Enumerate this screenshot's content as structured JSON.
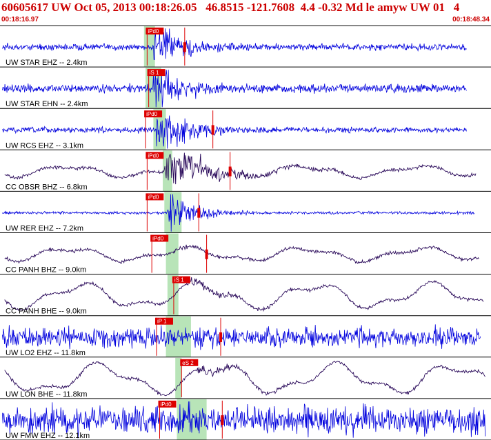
{
  "header": {
    "title": "60605617 UW Oct 05, 2013 00:18:26.05   46.8515 -121.7608  4.4 -0.32 Md le amyw UW 01   4",
    "start_time": "00:18:16.97",
    "end_time": "00:18:48.34"
  },
  "colors": {
    "header_text": "#cc0000",
    "trace_short_period": "#0000dd",
    "trace_broadband": "#2a0a5a",
    "pick_marker": "#dd0000",
    "pick_window": "#b8e4b8",
    "divider": "#000000"
  },
  "chart_data": {
    "type": "line",
    "title": "",
    "x_range_s": [
      0,
      31.37
    ],
    "traces": [
      {
        "label": "UW STAR EHZ -- 2.4km",
        "kind": "short",
        "amp": 0.12,
        "burst": 0.95,
        "burst_start": 9.8,
        "decay": 2.2,
        "picks": [
          {
            "label": "iPd0",
            "t": 9.4
          },
          {
            "label": "S",
            "t": 11.8
          }
        ],
        "window": [
          9.2,
          9.9
        ],
        "end_t": 29.8
      },
      {
        "label": "UW STAR EHN -- 2.4km",
        "kind": "short",
        "amp": 0.15,
        "burst": 0.9,
        "burst_start": 9.8,
        "decay": 2.0,
        "picks": [
          {
            "label": "iS 1",
            "t": 9.5
          }
        ],
        "window": [
          9.3,
          10.3
        ],
        "end_t": 29.8
      },
      {
        "label": "UW RCS EHZ -- 3.1km",
        "kind": "short",
        "amp": 0.1,
        "burst": 0.95,
        "burst_start": 10.0,
        "decay": 2.3,
        "picks": [
          {
            "label": "iPd0",
            "t": 9.3
          },
          {
            "label": "S",
            "t": 13.6
          }
        ],
        "window": [
          9.8,
          10.6
        ],
        "end_t": 29.8
      },
      {
        "label": "CC OBSR BHZ -- 6.8km",
        "kind": "broad",
        "amp": 0.25,
        "burst": 0.8,
        "burst_start": 10.5,
        "decay": 3.2,
        "picks": [
          {
            "label": "iPd0",
            "t": 9.4
          },
          {
            "label": "S",
            "t": 14.7
          }
        ],
        "window": [
          10.4,
          11.0
        ],
        "end_t": 30.4
      },
      {
        "label": "UW RER EHZ -- 7.2km",
        "kind": "short",
        "amp": 0.05,
        "burst": 0.9,
        "burst_start": 10.7,
        "decay": 1.6,
        "picks": [
          {
            "label": "iPd0",
            "t": 9.4
          },
          {
            "label": "S",
            "t": 12.7
          }
        ],
        "window": [
          10.5,
          11.6
        ],
        "end_t": 30.3
      },
      {
        "label": "CC PANH BHZ -- 9.0km",
        "kind": "broad",
        "amp": 0.3,
        "burst": 0.08,
        "burst_start": 11.0,
        "decay": 2.0,
        "picks": [
          {
            "label": "iPd0",
            "t": 9.7
          },
          {
            "label": "S",
            "t": 13.2
          }
        ],
        "window": [
          10.6,
          11.4
        ],
        "end_t": 30.6
      },
      {
        "label": "CC PANH BHE -- 9.0km",
        "kind": "broad",
        "amp": 0.55,
        "burst": 0.25,
        "burst_start": 12.0,
        "decay": 2.5,
        "picks": [
          {
            "label": "iS 1",
            "t": 11.1
          }
        ],
        "window": [
          10.7,
          11.4
        ],
        "end_t": 30.9
      },
      {
        "label": "UW LO2 EHZ -- 11.8km",
        "kind": "short",
        "amp": 0.35,
        "burst": 0.45,
        "burst_start": 11.4,
        "decay": 2.0,
        "picks": [
          {
            "label": "iP 1",
            "t": 10.0
          },
          {
            "label": "S",
            "t": 14.1
          }
        ],
        "window": [
          10.6,
          12.2
        ],
        "end_t": 30.7
      },
      {
        "label": "UW LON BHE -- 11.8km",
        "kind": "broad",
        "amp": 0.65,
        "burst": 0.25,
        "burst_start": 12.5,
        "decay": 2.5,
        "picks": [
          {
            "label": "eS 2",
            "t": 11.6
          }
        ],
        "window": [
          11.2,
          11.6
        ],
        "end_t": 31.0
      },
      {
        "label": "UW FMW EHZ -- 12.1km",
        "kind": "short",
        "amp": 0.5,
        "burst": 0.5,
        "burst_start": 12.0,
        "decay": 2.0,
        "picks": [
          {
            "label": "iPd0",
            "t": 10.2
          },
          {
            "label": "S",
            "t": 14.2
          }
        ],
        "window": [
          11.3,
          13.2
        ],
        "end_t": 31.0
      }
    ]
  }
}
